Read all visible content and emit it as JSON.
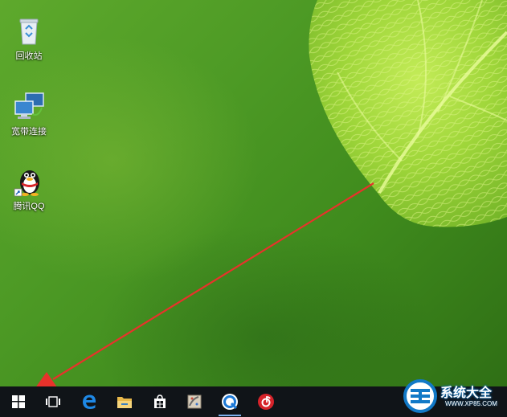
{
  "desktop": {
    "icons": [
      {
        "label": "回收站",
        "icon": "recycle-bin-icon"
      },
      {
        "label": "宽带连接",
        "icon": "broadband-connection-icon"
      },
      {
        "label": "腾讯QQ",
        "icon": "qq-penguin-icon"
      }
    ],
    "annotation": {
      "icon": "red-arrow-pointing-to-start-button",
      "color": "#e8322b"
    }
  },
  "taskbar": {
    "items": [
      {
        "icon": "windows-start-icon"
      },
      {
        "icon": "task-view-icon"
      },
      {
        "icon": "edge-browser-icon"
      },
      {
        "icon": "file-explorer-icon"
      },
      {
        "icon": "store-icon"
      },
      {
        "icon": "paint-app-icon"
      },
      {
        "icon": "qq-browser-icon",
        "active": true
      },
      {
        "icon": "netease-music-icon"
      }
    ]
  },
  "watermark": {
    "title": "系统大全",
    "url": "WWW.XP85.COM"
  },
  "colors": {
    "taskbar": "#101418",
    "arrow": "#e8322b",
    "edge": "#1e88e5",
    "music": "#d6232a"
  }
}
